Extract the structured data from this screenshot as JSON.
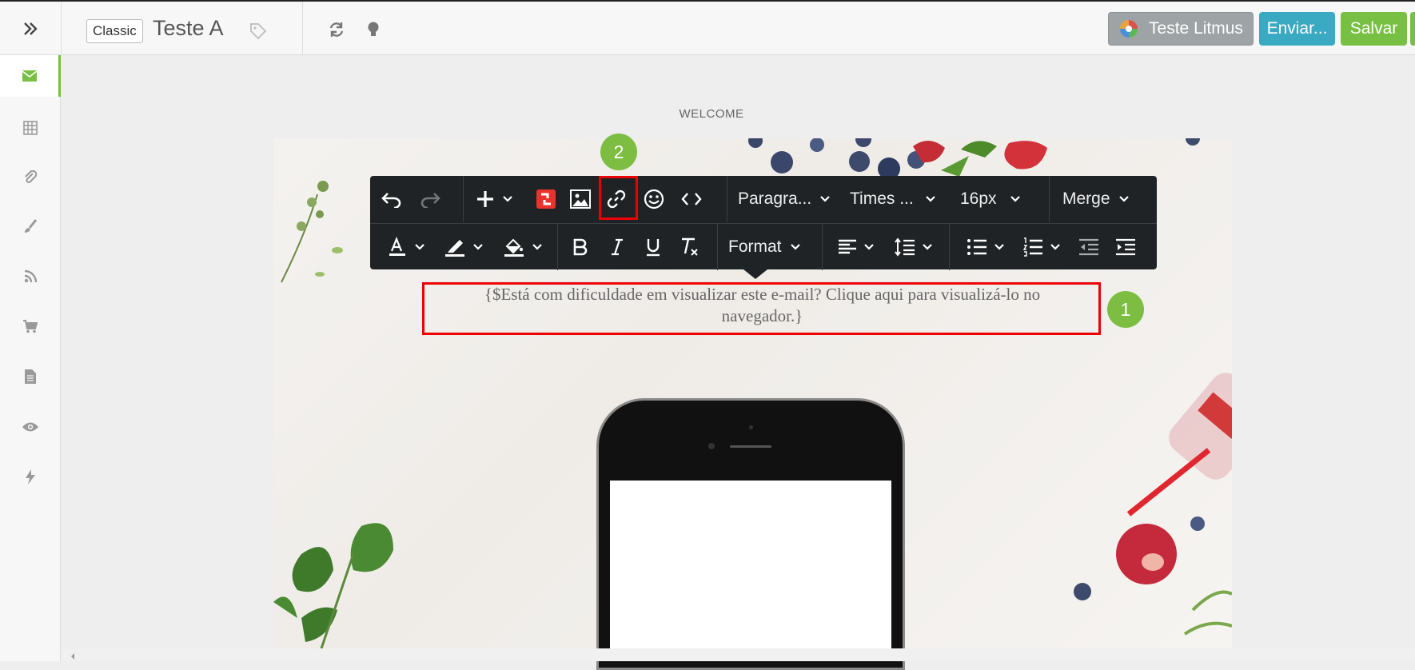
{
  "header": {
    "mode_badge": "Classic",
    "title": "Teste A",
    "buttons": {
      "litmus": "Teste Litmus",
      "send": "Enviar...",
      "save": "Salvar"
    }
  },
  "sidebar": {
    "items": [
      {
        "icon": "envelope-icon",
        "active": true
      },
      {
        "icon": "grid-icon"
      },
      {
        "icon": "paperclip-icon"
      },
      {
        "icon": "brush-icon"
      },
      {
        "icon": "rss-icon"
      },
      {
        "icon": "cart-icon"
      },
      {
        "icon": "document-icon"
      },
      {
        "icon": "eye-icon"
      },
      {
        "icon": "bolt-icon"
      }
    ]
  },
  "canvas": {
    "section_label": "WELCOME"
  },
  "toolbar": {
    "paragraph": "Paragra...",
    "font": "Times ...",
    "size": "16px",
    "merge": "Merge",
    "format": "Format"
  },
  "editor": {
    "line1": "{$Está com dificuldade em visualizar este e-mail? Clique aqui para visualizá-lo no",
    "line2": "navegador.}"
  },
  "markers": {
    "one": "1",
    "two": "2"
  },
  "colors": {
    "accent_green": "#78c043",
    "send_blue": "#3aa9c2",
    "highlight_red": "#e00000",
    "toolbar_bg": "#1f2326"
  }
}
